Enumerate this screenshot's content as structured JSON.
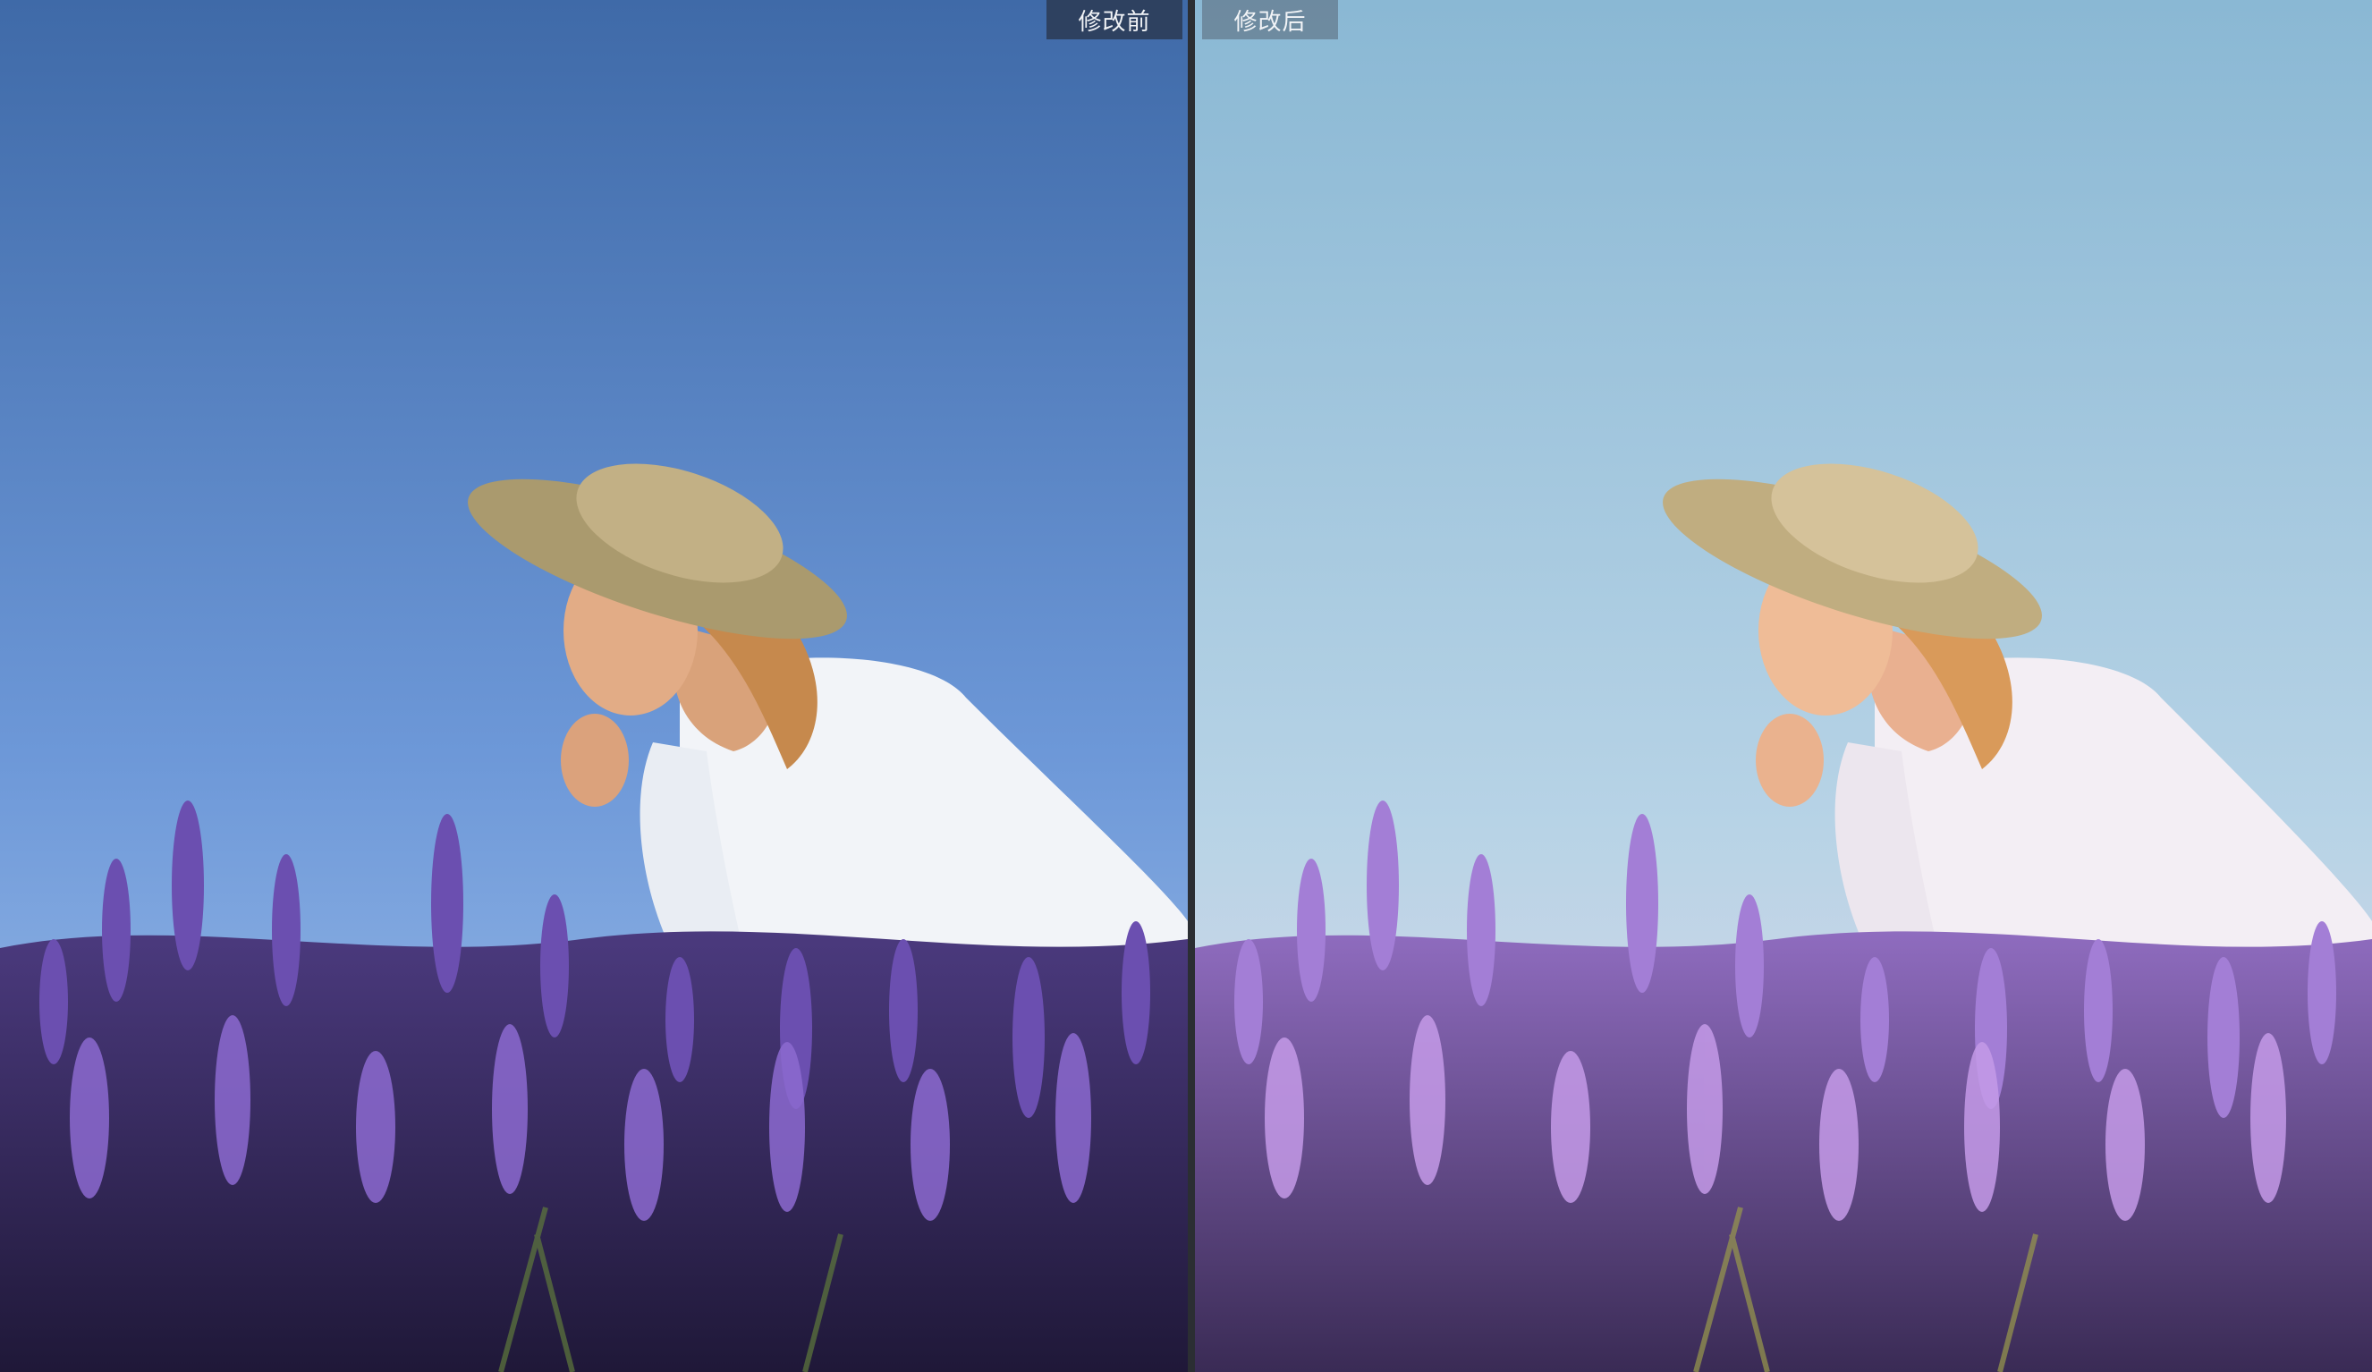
{
  "compare": {
    "before_label": "修改前",
    "after_label": "修改后"
  },
  "colors": {
    "before_sky_top": "#3f6aa8",
    "before_sky_bottom": "#8fb6e8",
    "after_sky_top": "#8ab8d4",
    "after_sky_bottom": "#e3dbe9",
    "lavender_dark": "#3d2d6e",
    "lavender_light": "#b28ad6",
    "dress": "#f4f6fa",
    "hat": "#b8a57a"
  }
}
